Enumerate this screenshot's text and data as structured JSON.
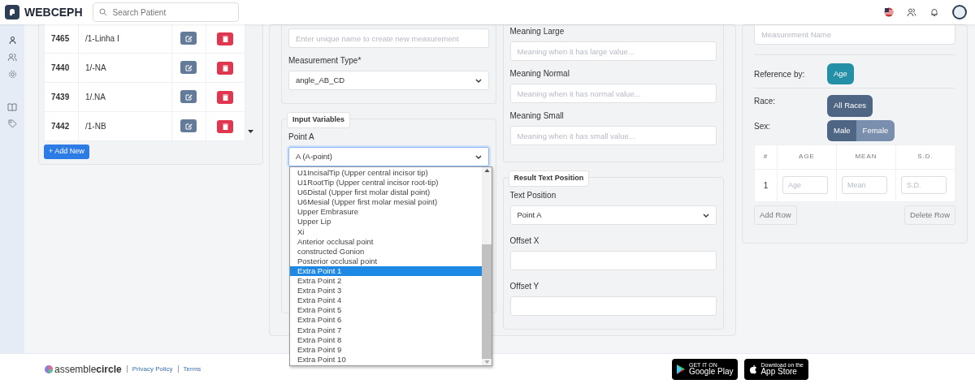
{
  "header": {
    "logo_text": "WEBCEPH",
    "search_placeholder": "Search Patient"
  },
  "measurements": {
    "rows": [
      {
        "id": "7465",
        "name": "/1-Linha I"
      },
      {
        "id": "7440",
        "name": "1/-NA"
      },
      {
        "id": "7439",
        "name": "1/.NA"
      },
      {
        "id": "7442",
        "name": "/1-NB"
      }
    ],
    "add_button": "+ Add New"
  },
  "form": {
    "name_placeholder": "Enter unique name to create new measurement",
    "type_label": "Measurement Type*",
    "type_value": "angle_AB_CD",
    "input_variables": {
      "legend": "Input Variables",
      "point_label": "Point A",
      "point_value": "A (A-point)",
      "options": [
        {
          "label": "U1IncisalTip (Upper central incisor tip)",
          "selected": false
        },
        {
          "label": "U1RootTip (Upper central incisor root-tip)",
          "selected": false
        },
        {
          "label": "U6Distal (Upper first molar distal point)",
          "selected": false
        },
        {
          "label": "U6Mesial (Upper first molar mesial point)",
          "selected": false
        },
        {
          "label": "Upper Embrasure",
          "selected": false
        },
        {
          "label": "Upper Lip",
          "selected": false
        },
        {
          "label": "Xi",
          "selected": false
        },
        {
          "label": "Anterior occlusal point",
          "selected": false
        },
        {
          "label": "constructed Gonion",
          "selected": false
        },
        {
          "label": "Posterior occlusal point",
          "selected": false
        },
        {
          "label": "Extra Point 1",
          "selected": true
        },
        {
          "label": "Extra Point 2",
          "selected": false
        },
        {
          "label": "Extra Point 3",
          "selected": false
        },
        {
          "label": "Extra Point 4",
          "selected": false
        },
        {
          "label": "Extra Point 5",
          "selected": false
        },
        {
          "label": "Extra Point 6",
          "selected": false
        },
        {
          "label": "Extra Point 7",
          "selected": false
        },
        {
          "label": "Extra Point 8",
          "selected": false
        },
        {
          "label": "Extra Point 9",
          "selected": false
        },
        {
          "label": "Extra Point 10",
          "selected": false
        }
      ]
    },
    "meanings": [
      {
        "label": "Meaning Large",
        "placeholder": "Meaning when it has large value..."
      },
      {
        "label": "Meaning Normal",
        "placeholder": "Meaning when it has normal value..."
      },
      {
        "label": "Meaning Small",
        "placeholder": "Meaning when it has small value..."
      }
    ],
    "result": {
      "legend": "Result Text Position",
      "position_label": "Text Position",
      "position_value": "Point A",
      "offset_x_label": "Offset X",
      "offset_y_label": "Offset Y"
    }
  },
  "reference": {
    "name_placeholder": "Measurement Name",
    "reference_label": "Reference by:",
    "reference_options": [
      {
        "label": "Age",
        "selected": true
      }
    ],
    "race_label": "Race:",
    "race_options": [
      {
        "label": "All Races",
        "selected": true
      }
    ],
    "sex_label": "Sex:",
    "sex_options": [
      {
        "label": "Male",
        "selected": true
      },
      {
        "label": "Female",
        "selected": false
      }
    ],
    "columns": [
      "#",
      "AGE",
      "MEAN",
      "S.D."
    ],
    "rows": [
      {
        "index": "1",
        "placeholders": [
          "Age",
          "Mean",
          "S.D."
        ]
      }
    ],
    "add_row": "Add Row",
    "delete_row": "Delete Row"
  },
  "footer": {
    "brand_light": "assemble",
    "brand_bold": "circle",
    "links": [
      "Privacy Policy",
      "Terms"
    ],
    "badges": [
      {
        "small": "GET IT ON",
        "big": "Google Play"
      },
      {
        "small": "Download on the",
        "big": "App Store"
      }
    ]
  }
}
